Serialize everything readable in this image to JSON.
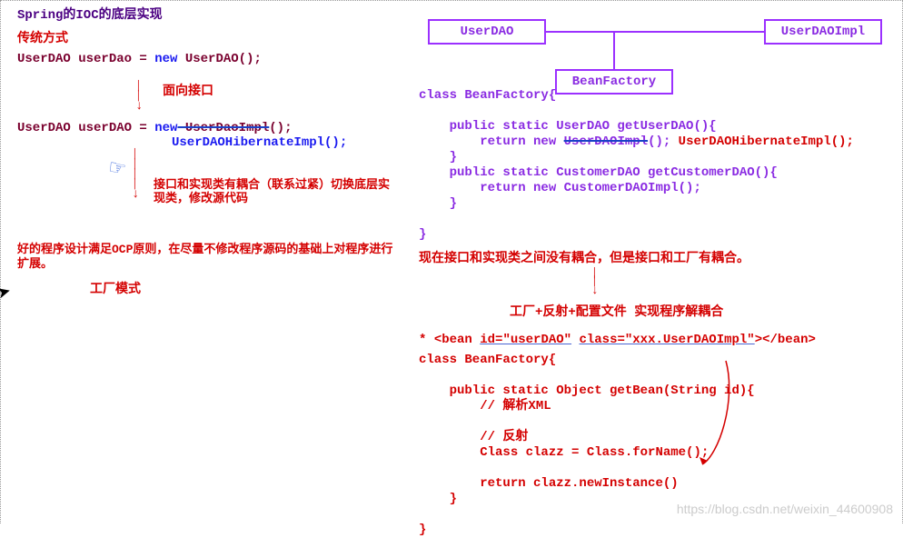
{
  "title": "Spring的IOC的底层实现",
  "left": {
    "traditional_label": "传统方式",
    "code1_a": "UserDAO userDao = ",
    "code1_b": "new",
    "code1_c": " UserDAO();",
    "annot1": "面向接口",
    "code2_a": "UserDAO userDAO = ",
    "code2_b": "new",
    "code2_strike": " UserDaoImpl",
    "code2_d": "();",
    "code2_line2": "UserDAOHibernateImpl();",
    "annot2": "接口和实现类有耦合（联系过紧）切换底层实现类，修改源代码",
    "ocp": "好的程序设计满足OCP原则，在尽量不修改程序源码的基础上对程序进行扩展。",
    "factory_label": "工厂模式"
  },
  "uml": {
    "box1": "UserDAO",
    "box2": "UserDAOImpl",
    "box3": "BeanFactory"
  },
  "right": {
    "code1": "class BeanFactory{\n\n    public static UserDAO getUserDAO(){\n        return new ",
    "code1_strike": "UserDAOImpl",
    "code1_after": "();",
    "code1_red": " UserDAOHibernateImpl();",
    "code1_cont": "\n    }\n    public static CustomerDAO getCustomerDAO(){\n        return new CustomerDAOImpl();\n    }\n\n}",
    "note": "现在接口和实现类之间没有耦合，但是接口和工厂有耦合。",
    "solution": "工厂+反射+配置文件   实现程序解耦合",
    "bean_star": "* ",
    "bean_open": "<bean ",
    "bean_id": "id=\"userDAO\"",
    "bean_sp": "  ",
    "bean_class": "class=\"xxx.UserDAOImpl\"",
    "bean_close": "></bean>",
    "code2": "class BeanFactory{\n\n    public static Object getBean(String id){\n        // 解析XML\n\n        // 反射\n        Class clazz = Class.forName();\n\n        return clazz.newInstance()\n    }\n\n}"
  },
  "watermark": "https://blog.csdn.net/weixin_44600908",
  "chart_data": {
    "type": "diagram",
    "title": "Spring的IOC的底层实现",
    "uml_boxes": [
      "UserDAO",
      "UserDAOImpl",
      "BeanFactory"
    ],
    "uml_associations": [
      [
        "UserDAO",
        "UserDAOImpl"
      ],
      [
        "UserDAO-line",
        "BeanFactory"
      ]
    ],
    "left_flow": [
      {
        "code": "UserDAO userDao = new UserDAO();"
      },
      {
        "arrow": "面向接口"
      },
      {
        "code": "UserDAO userDAO = new UserDaoImpl();",
        "replaced_by": "UserDAOHibernateImpl();"
      },
      {
        "arrow": "接口和实现类有耦合（联系过紧）切换底层实现类，修改源代码"
      },
      {
        "note": "好的程序设计满足OCP原则，在尽量不修改程序源码的基础上对程序进行扩展。"
      },
      {
        "label": "工厂模式"
      }
    ],
    "right_flow": [
      {
        "class": "BeanFactory",
        "methods": [
          {
            "sig": "public static UserDAO getUserDAO()",
            "body": "return new UserDAOImpl(); → UserDAOHibernateImpl();"
          },
          {
            "sig": "public static CustomerDAO getCustomerDAO()",
            "body": "return new CustomerDAOImpl();"
          }
        ]
      },
      {
        "note": "现在接口和实现类之间没有耦合，但是接口和工厂有耦合。"
      },
      {
        "arrow": "工厂+反射+配置文件 实现程序解耦合"
      },
      {
        "xml": "<bean id=\"userDAO\" class=\"xxx.UserDAOImpl\"></bean>"
      },
      {
        "class": "BeanFactory",
        "methods": [
          {
            "sig": "public static Object getBean(String id)",
            "body": "// 解析XML  // 反射  Class clazz = Class.forName();  return clazz.newInstance()"
          }
        ]
      }
    ]
  }
}
